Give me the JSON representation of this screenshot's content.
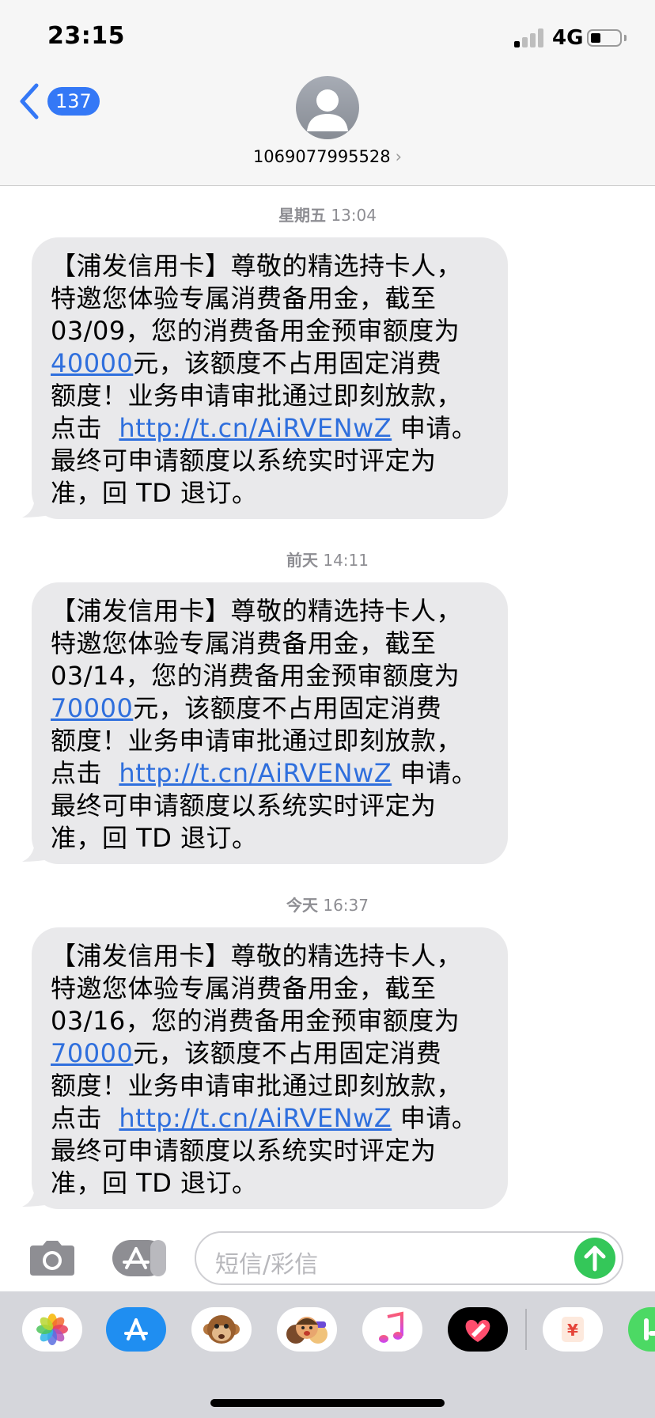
{
  "status_bar": {
    "time": "23:15",
    "network": "4G"
  },
  "header": {
    "back_count": "137",
    "contact": "1069077995528",
    "chevron": "›"
  },
  "messages": [
    {
      "timestamp_day": "星期五",
      "timestamp_time": "13:04",
      "lines": [
        "【浦发信用卡】尊敬的精选持卡人，",
        "特邀您体验专属消费备用金，截至",
        "03/09，您的消费备用金预审额度为"
      ],
      "amount": "40000",
      "after_amount": "元，该额度不占用固定消费",
      "line5": "额度！业务申请审批通过即刻放款，",
      "link_prefix": "点击",
      "link": "http://t.cn/AiRVENwZ",
      "link_suffix": "申请。",
      "line7": "最终可申请额度以系统实时评定为",
      "line8": "准，回 TD 退订。"
    },
    {
      "timestamp_day": "前天",
      "timestamp_time": "14:11",
      "lines": [
        "【浦发信用卡】尊敬的精选持卡人，",
        "特邀您体验专属消费备用金，截至",
        "03/14，您的消费备用金预审额度为"
      ],
      "amount": "70000",
      "after_amount": "元，该额度不占用固定消费",
      "line5": "额度！业务申请审批通过即刻放款，",
      "link_prefix": "点击",
      "link": "http://t.cn/AiRVENwZ",
      "link_suffix": "申请。",
      "line7": "最终可申请额度以系统实时评定为",
      "line8": "准，回 TD 退订。"
    },
    {
      "timestamp_day": "今天",
      "timestamp_time": "16:37",
      "lines": [
        "【浦发信用卡】尊敬的精选持卡人，",
        "特邀您体验专属消费备用金，截至",
        "03/16，您的消费备用金预审额度为"
      ],
      "amount": "70000",
      "after_amount": "元，该额度不占用固定消费",
      "line5": "额度！业务申请审批通过即刻放款，",
      "link_prefix": "点击",
      "link": "http://t.cn/AiRVENwZ",
      "link_suffix": "申请。",
      "line7": "最终可申请额度以系统实时评定为",
      "line8": "准，回 TD 退订。"
    }
  ],
  "input": {
    "placeholder": "短信/彩信"
  },
  "app_drawer": {
    "apps": [
      "photos-icon",
      "app-store-icon",
      "monkey-memoji-icon",
      "memoji-stickers-icon",
      "music-icon",
      "digital-touch-icon",
      "yuan-payment-icon",
      "green-app-icon"
    ]
  },
  "colors": {
    "link": "#2f6fdd",
    "bubble": "#e9e9eb",
    "send": "#34c759",
    "badge": "#3478f6"
  }
}
